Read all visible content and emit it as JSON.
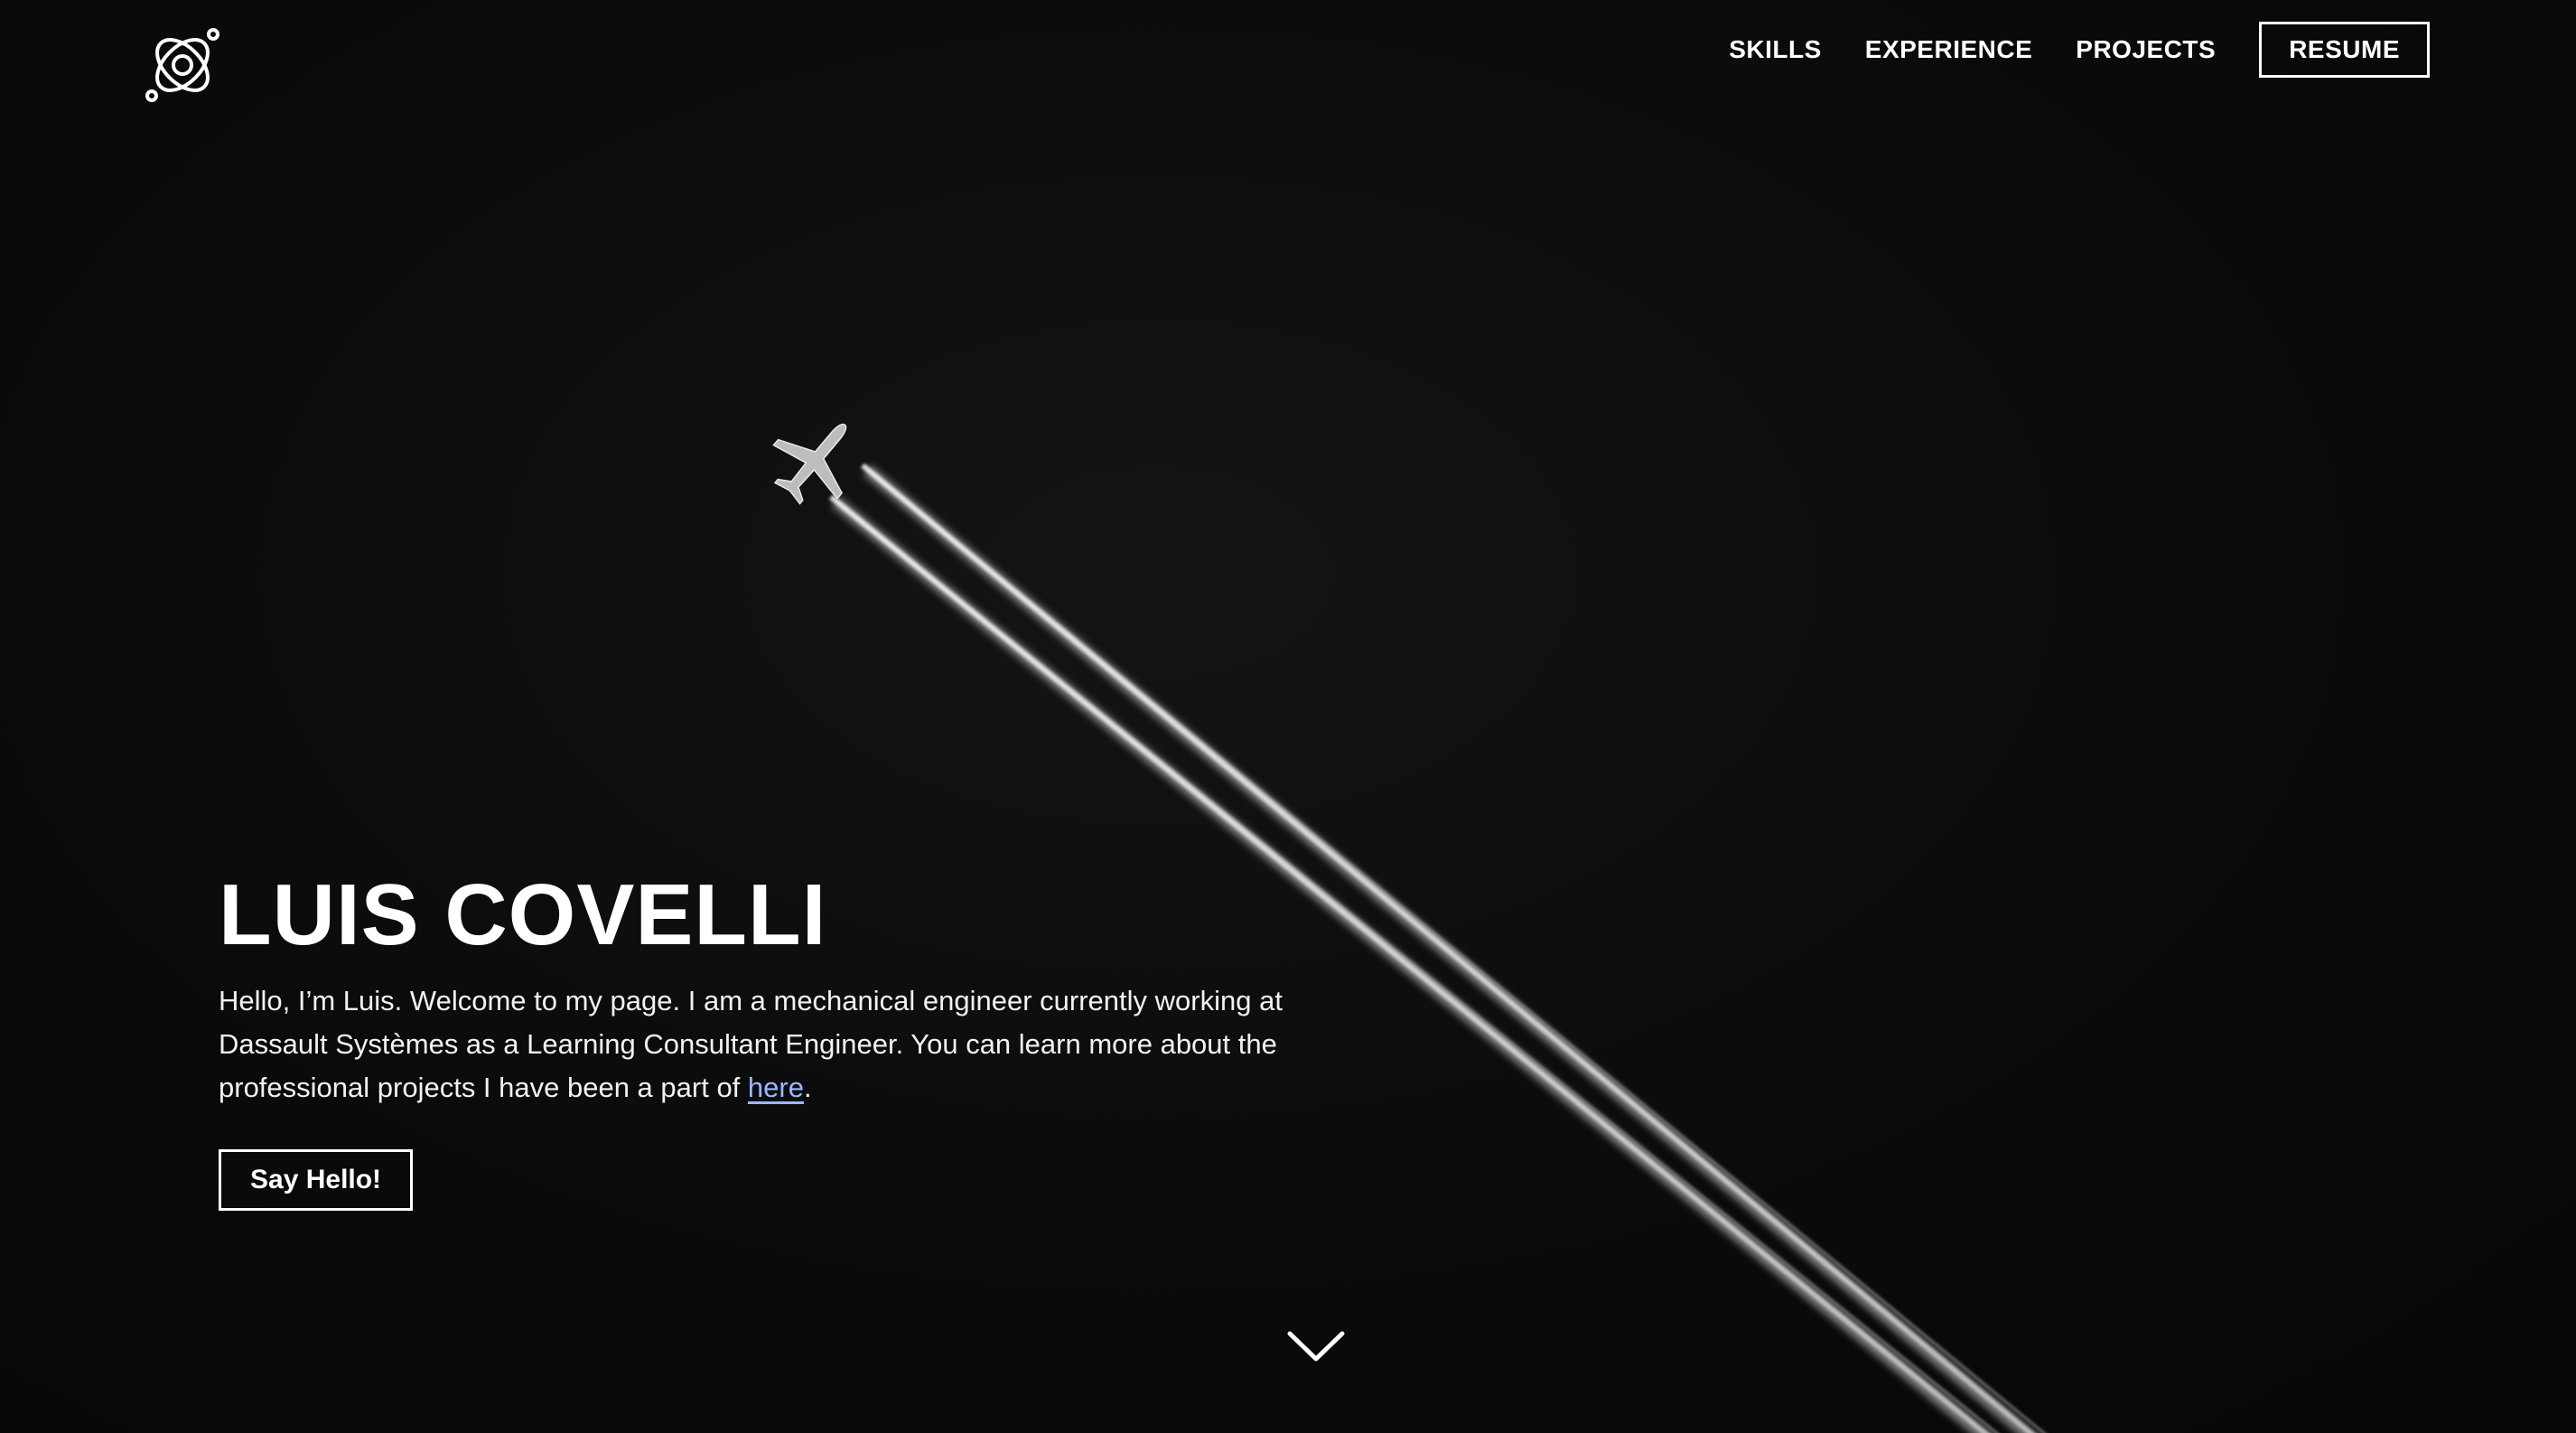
{
  "nav": {
    "logo_icon": "atom-orbit-icon",
    "links": [
      "SKILLS",
      "EXPERIENCE",
      "PROJECTS"
    ],
    "resume_label": "RESUME"
  },
  "hero": {
    "title": "LUIS COVELLI",
    "intro_text": "Hello, I’m Luis. Welcome to my page. I am a mechanical engineer currently working at Dassault Systèmes as a Learning Consultant Engineer. You can learn more about the professional projects I have been a part of ",
    "intro_link": "here",
    "intro_end": ".",
    "cta_label": "Say Hello!",
    "background_image": "airplane-contrail-night-sky",
    "scroll_icon": "chevron-down-icon"
  },
  "colors": {
    "background": "#0a0a0b",
    "text": "#ffffff",
    "link": "#9bb8ff"
  }
}
